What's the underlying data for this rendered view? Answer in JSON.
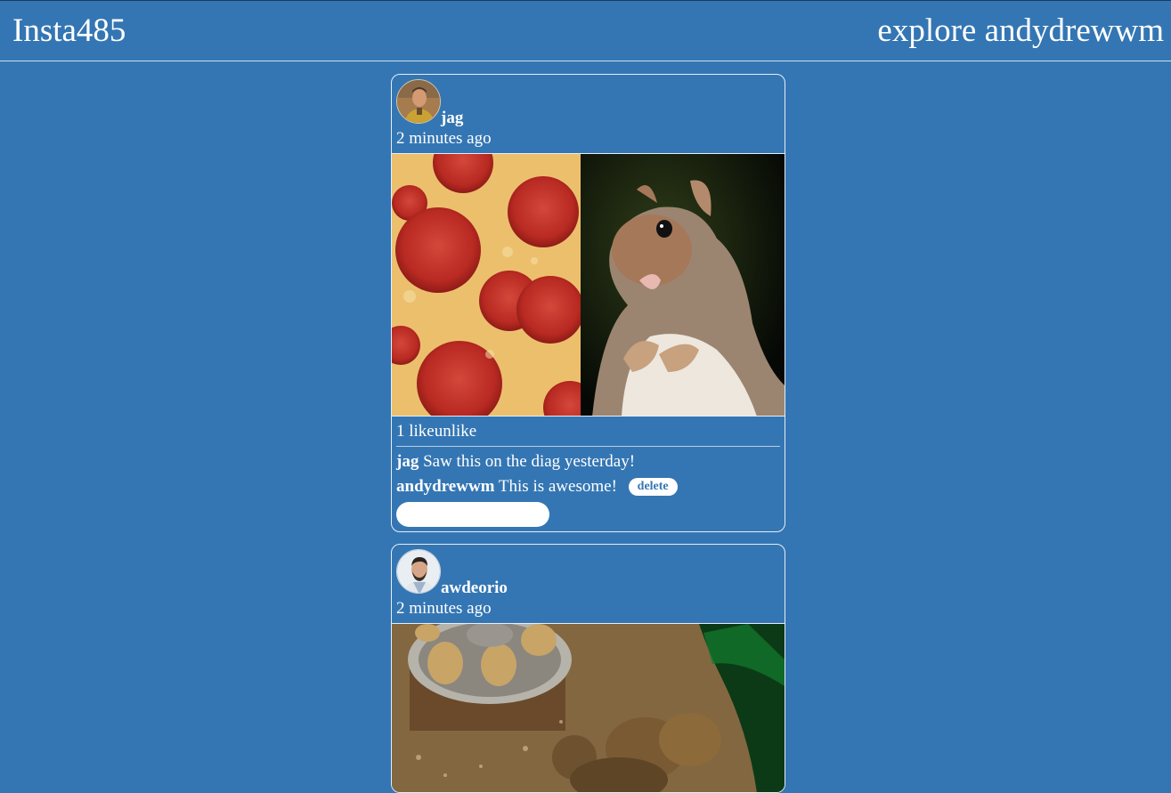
{
  "header": {
    "logo": "Insta485",
    "explore_label": "explore",
    "username": "andydrewwm"
  },
  "posts": [
    {
      "owner": "jag",
      "timestamp": "2 minutes ago",
      "likes_text": "1 like",
      "like_button_label": "unlike",
      "comments": [
        {
          "owner": "jag",
          "text": "Saw this on the diag yesterday!"
        },
        {
          "owner": "andydrewwm",
          "text": "This is awesome!",
          "delete_label": "delete"
        }
      ],
      "comment_placeholder": ""
    },
    {
      "owner": "awdeorio",
      "timestamp": "2 minutes ago"
    }
  ],
  "colors": {
    "background": "#3476b3",
    "text": "#ffffff",
    "border": "#e6eef6"
  }
}
